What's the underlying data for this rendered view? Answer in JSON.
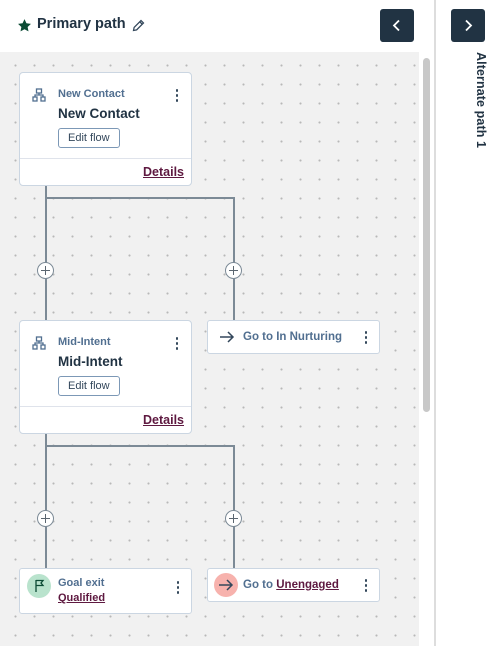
{
  "header": {
    "title": "Primary path",
    "collapse_icon": "chevron-left-icon",
    "edit_icon": "pencil-icon",
    "star_icon": "star-icon"
  },
  "right_panel": {
    "label": "Alternate path 1",
    "expand_icon": "chevron-right-icon"
  },
  "nodes": {
    "new_contact": {
      "kicker": "New Contact",
      "name": "New Contact",
      "edit_label": "Edit flow",
      "details_label": "Details"
    },
    "mid_intent": {
      "kicker": "Mid-Intent",
      "name": "Mid-Intent",
      "edit_label": "Edit flow",
      "details_label": "Details"
    },
    "go_nurturing": {
      "text": "Go to In Nurturing"
    },
    "goal_exit": {
      "kicker": "Goal exit",
      "link": "Qualified"
    },
    "go_unengaged": {
      "prefix": "Go to",
      "link": "Unengaged"
    }
  },
  "colors": {
    "brand_dark": "#213343",
    "link": "#5e1940",
    "goal_green": "#b9e3cd",
    "exit_red": "#f7b2ad",
    "canvas_bg": "#f1f1f1"
  }
}
